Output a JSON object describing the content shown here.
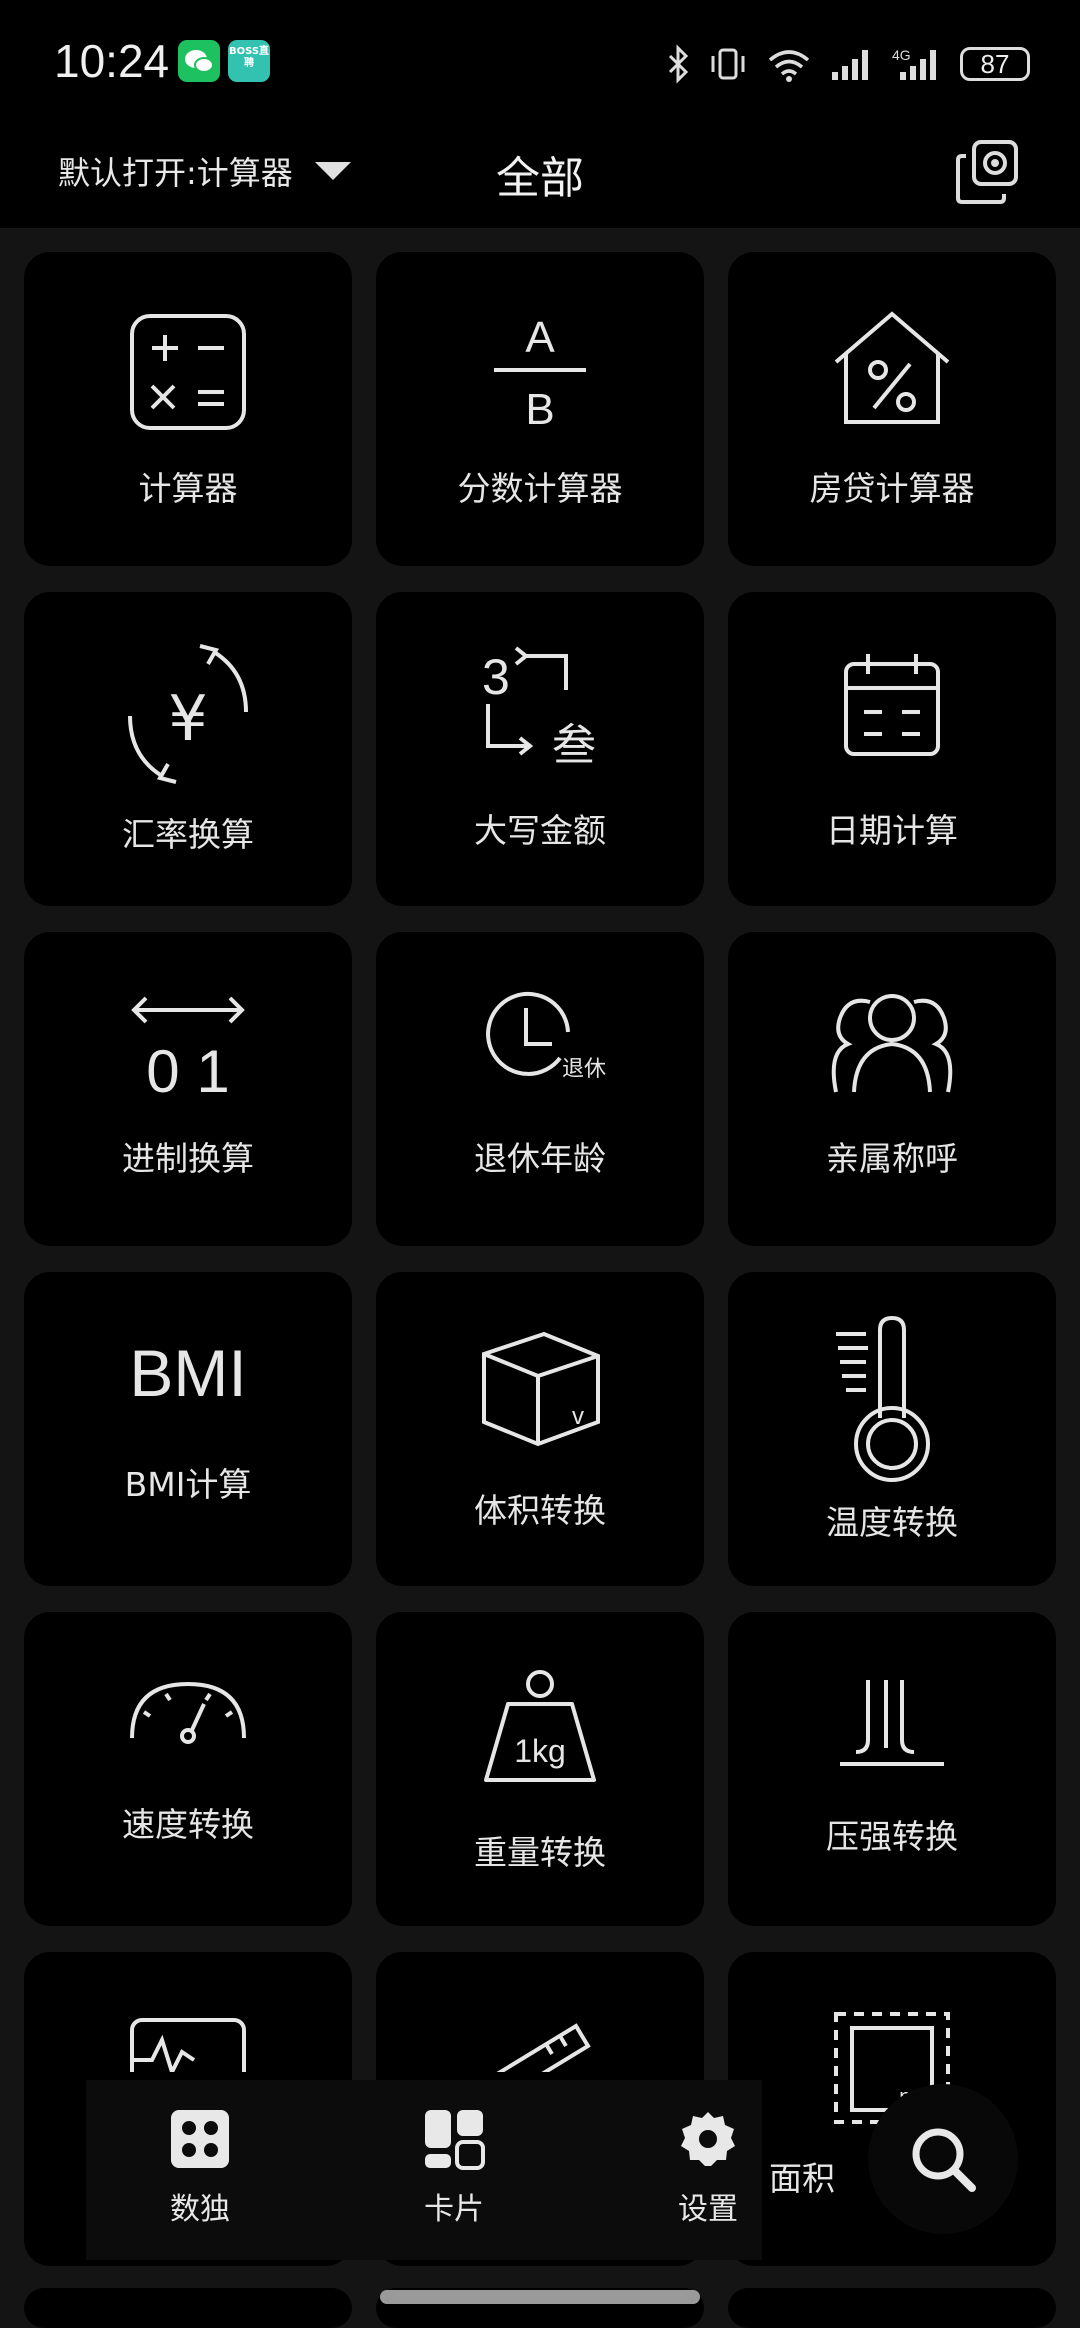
{
  "status": {
    "time": "10:24",
    "battery": "87",
    "network": "4G",
    "boss_badge": "BOSS直聘"
  },
  "header": {
    "default_open": "默认打开:计算器",
    "title": "全部"
  },
  "tools": [
    {
      "label": "计算器",
      "icon": "calculator-icon"
    },
    {
      "label": "分数计算器",
      "icon": "fraction-icon"
    },
    {
      "label": "房贷计算器",
      "icon": "mortgage-house-icon"
    },
    {
      "label": "汇率换算",
      "icon": "exchange-rate-icon"
    },
    {
      "label": "大写金额",
      "icon": "uppercase-amount-icon"
    },
    {
      "label": "日期计算",
      "icon": "calendar-icon"
    },
    {
      "label": "进制换算",
      "icon": "base-conversion-icon"
    },
    {
      "label": "退休年龄",
      "icon": "retirement-clock-icon"
    },
    {
      "label": "亲属称呼",
      "icon": "relatives-icon"
    },
    {
      "label": "BMI计算",
      "icon": "bmi-icon"
    },
    {
      "label": "体积转换",
      "icon": "volume-cube-icon"
    },
    {
      "label": "温度转换",
      "icon": "thermometer-icon"
    },
    {
      "label": "速度转换",
      "icon": "speedometer-icon"
    },
    {
      "label": "重量转换",
      "icon": "weight-icon"
    },
    {
      "label": "压强转换",
      "icon": "pressure-icon"
    },
    {
      "label": "",
      "icon": "blood-pressure-icon"
    },
    {
      "label": "",
      "icon": "ruler-icon"
    },
    {
      "label": "面积",
      "icon": "area-icon"
    }
  ],
  "icon_text": {
    "fraction_top": "A",
    "fraction_bottom": "B",
    "yen": "¥",
    "three": "3",
    "three_upper": "叁",
    "binary": "0 1",
    "retire": "退休",
    "bmi": "BMI",
    "volume_v": "v",
    "kg": "1kg",
    "area_unit": "m²"
  },
  "nav": {
    "sudoku": "数独",
    "cards": "卡片",
    "settings": "设置"
  },
  "colors": {
    "background": "#141414",
    "tile": "#000000",
    "text": "#e6e6e6",
    "wechat": "#1ec15f",
    "boss": "#33c2b0"
  }
}
